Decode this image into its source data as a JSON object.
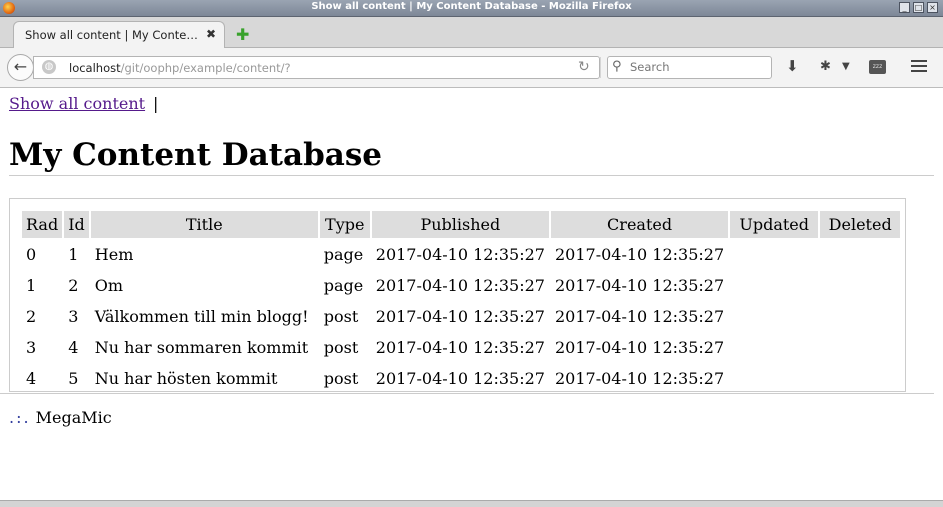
{
  "window": {
    "title": "Show all content | My Content Database - Mozilla Firefox"
  },
  "tabs": [
    {
      "label": "Show all content | My Conte…",
      "close": "✖"
    }
  ],
  "newtab": {
    "label": "✚"
  },
  "navbar": {
    "back_icon": "←",
    "url_host": "localhost",
    "url_path": "/git/oophp/example/content/?",
    "reload_icon": "↻",
    "search_placeholder": "Search",
    "download_icon": "⬇",
    "menu_icon": "hamburger"
  },
  "page": {
    "nav_link": "Show all content",
    "nav_sep": "|",
    "heading": "My Content Database",
    "table": {
      "headers": [
        "Rad",
        "Id",
        "Title",
        "Type",
        "Published",
        "Created",
        "Updated",
        "Deleted"
      ],
      "rows": [
        [
          "0",
          "1",
          "Hem",
          "page",
          "2017-04-10 12:35:27",
          "2017-04-10 12:35:27",
          "",
          ""
        ],
        [
          "1",
          "2",
          "Om",
          "page",
          "2017-04-10 12:35:27",
          "2017-04-10 12:35:27",
          "",
          ""
        ],
        [
          "2",
          "3",
          "Välkommen till min blogg!",
          "post",
          "2017-04-10 12:35:27",
          "2017-04-10 12:35:27",
          "",
          ""
        ],
        [
          "3",
          "4",
          "Nu har sommaren kommit",
          "post",
          "2017-04-10 12:35:27",
          "2017-04-10 12:35:27",
          "",
          ""
        ],
        [
          "4",
          "5",
          "Nu har hösten kommit",
          "post",
          "2017-04-10 12:35:27",
          "2017-04-10 12:35:27",
          "",
          ""
        ]
      ]
    },
    "footer": {
      "dots": ".:.",
      "text": "MegaMic"
    }
  }
}
